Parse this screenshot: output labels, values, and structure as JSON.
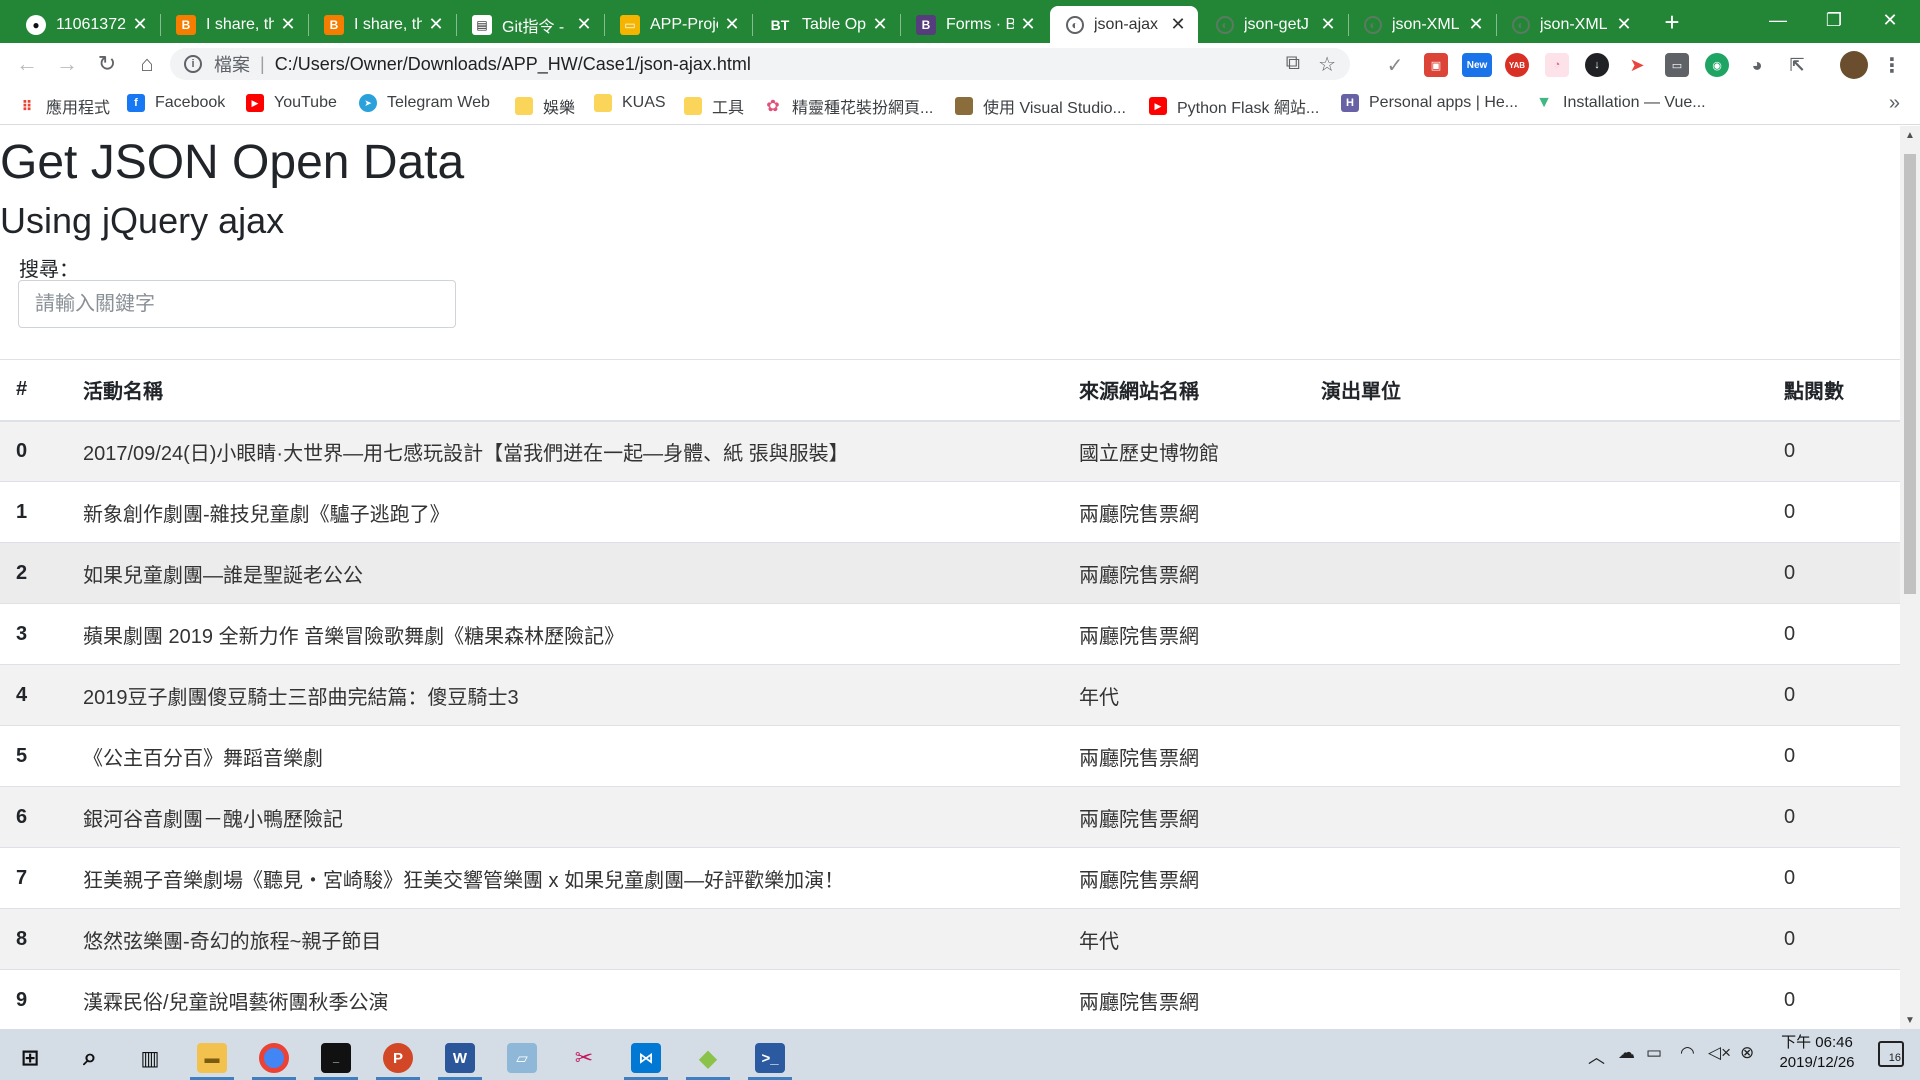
{
  "browser": {
    "tabs": [
      {
        "title": "11061372",
        "favicon": "github-icon",
        "active": false
      },
      {
        "title": "I share, th",
        "favicon": "blogger-icon",
        "active": false
      },
      {
        "title": "I share, th",
        "favicon": "blogger-icon",
        "active": false
      },
      {
        "title": "Git指令 - I",
        "favicon": "document-icon",
        "active": false
      },
      {
        "title": "APP-Proje",
        "favicon": "slides-icon",
        "active": false
      },
      {
        "title": "Table Opt",
        "favicon": "bootstrap-table-icon",
        "badge": "BT",
        "active": false
      },
      {
        "title": "Forms · Bo",
        "favicon": "bootstrap-icon",
        "badge": "B",
        "active": false
      },
      {
        "title": "json-ajax",
        "favicon": "globe-icon",
        "active": true
      },
      {
        "title": "json-getJ",
        "favicon": "globe-icon",
        "active": false
      },
      {
        "title": "json-XML",
        "favicon": "globe-icon",
        "active": false
      },
      {
        "title": "json-XML",
        "favicon": "globe-icon",
        "active": false
      }
    ],
    "address": {
      "file_label": "檔案",
      "url": "C:/Users/Owner/Downloads/APP_HW/Case1/json-ajax.html"
    },
    "extensions": {
      "new_badge": "New",
      "yab_badge": "YAB"
    },
    "bookmarks": [
      {
        "label": "應用程式",
        "icon": "apps-grid-icon"
      },
      {
        "label": "Facebook",
        "icon": "facebook-icon"
      },
      {
        "label": "YouTube",
        "icon": "youtube-icon"
      },
      {
        "label": "Telegram Web",
        "icon": "telegram-icon"
      },
      {
        "label": "娛樂",
        "icon": "folder-icon"
      },
      {
        "label": "KUAS",
        "icon": "folder-icon"
      },
      {
        "label": "工具",
        "icon": "folder-icon"
      },
      {
        "label": "精靈種花裝扮網頁...",
        "icon": "flower-icon"
      },
      {
        "label": "使用 Visual Studio...",
        "icon": "image-icon"
      },
      {
        "label": "Python Flask 網站...",
        "icon": "youtube-icon"
      },
      {
        "label": "Personal apps | He...",
        "icon": "heroku-icon"
      },
      {
        "label": "Installation — Vue...",
        "icon": "vue-icon"
      }
    ]
  },
  "page": {
    "title": "Get JSON Open Data",
    "subtitle": "Using jQuery ajax",
    "search": {
      "label": "搜尋：",
      "placeholder": "請輸入關鍵字",
      "value": ""
    },
    "table": {
      "headers": [
        "#",
        "活動名稱",
        "來源網站名稱",
        "演出單位",
        "點閱數"
      ],
      "rows": [
        [
          "0",
          "2017/09/24(日)小眼睛·大世界—用七感玩設計【當我們迸在一起—身體、紙 張與服裝】",
          "國立歷史博物館",
          "",
          "0"
        ],
        [
          "1",
          "新象創作劇團-雜技兒童劇《驢子逃跑了》",
          "兩廳院售票網",
          "",
          "0"
        ],
        [
          "2",
          "如果兒童劇團—誰是聖誕老公公",
          "兩廳院售票網",
          "",
          "0"
        ],
        [
          "3",
          "蘋果劇團 2019 全新力作 音樂冒險歌舞劇《糖果森林歷險記》",
          "兩廳院售票網",
          "",
          "0"
        ],
        [
          "4",
          "2019豆子劇團傻豆騎士三部曲完結篇：傻豆騎士3",
          "年代",
          "",
          "0"
        ],
        [
          "5",
          "《公主百分百》舞蹈音樂劇",
          "兩廳院售票網",
          "",
          "0"
        ],
        [
          "6",
          "銀河谷音劇團－醜小鴨歷險記",
          "兩廳院售票網",
          "",
          "0"
        ],
        [
          "7",
          "狂美親子音樂劇場《聽見・宮崎駿》狂美交響管樂團 x 如果兒童劇團—好評歡樂加演！",
          "兩廳院售票網",
          "",
          "0"
        ],
        [
          "8",
          "悠然弦樂團-奇幻的旅程~親子節目",
          "年代",
          "",
          "0"
        ],
        [
          "9",
          "漢霖民俗/兒童說唱藝術團秋季公演",
          "兩廳院售票網",
          "",
          "0"
        ]
      ]
    }
  },
  "taskbar": {
    "apps": [
      {
        "name": "windows-start-icon"
      },
      {
        "name": "search-icon"
      },
      {
        "name": "task-view-icon"
      },
      {
        "name": "file-explorer-icon",
        "running": true
      },
      {
        "name": "chrome-icon",
        "running": true
      },
      {
        "name": "terminal-icon",
        "running": true
      },
      {
        "name": "powerpoint-icon",
        "running": true
      },
      {
        "name": "word-icon",
        "running": true
      },
      {
        "name": "notepad-icon"
      },
      {
        "name": "snipping-icon"
      },
      {
        "name": "vscode-icon",
        "running": true
      },
      {
        "name": "git-gui-icon",
        "running": true
      },
      {
        "name": "powershell-icon",
        "running": true
      }
    ],
    "clock": {
      "time": "下午 06:46",
      "date": "2019/12/26"
    },
    "notifications": "16"
  },
  "colors": {
    "tabstrip": "#238636",
    "taskbar": "#d4dde6",
    "table_stripe": "#f2f2f2"
  }
}
